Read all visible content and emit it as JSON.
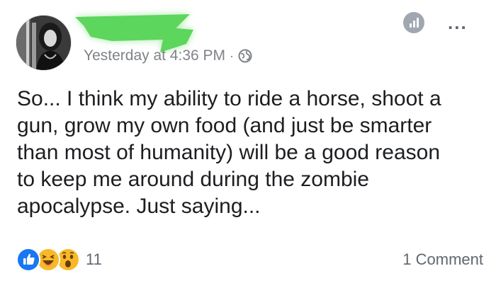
{
  "post": {
    "timestamp": "Yesterday at 4:36 PM",
    "separator": "·",
    "privacy_icon": "globe-icon",
    "body_lines": [
      "So... I think my ability to ride a horse, shoot a",
      "gun, grow my own food (and just be smarter",
      "than most of humanity) will be a good reason",
      "to keep me around during the zombie",
      "apocalypse. Just saying..."
    ]
  },
  "header_icons": {
    "stats": "stats-icon",
    "more": "more-options-icon",
    "more_glyph": "..."
  },
  "reactions": {
    "icons": [
      "like-icon",
      "haha-icon",
      "wow-icon"
    ],
    "count": "11"
  },
  "comments": {
    "label": "1 Comment"
  },
  "colors": {
    "like_blue": "#1877f2",
    "emoji_yellow": "#f7b928",
    "redaction_green": "#5cd65c",
    "meta_gray": "#7f8287"
  }
}
